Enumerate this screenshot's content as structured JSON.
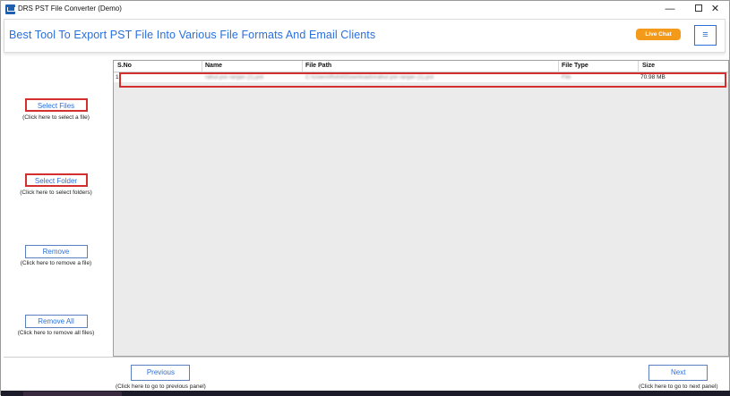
{
  "window": {
    "title": "DRS PST File Converter (Demo)",
    "min_glyph": "—",
    "close_glyph": "✕"
  },
  "header": {
    "title": "Best Tool To Export PST File Into Various File Formats And Email Clients",
    "live_chat": "Live Chat",
    "menu_glyph": "≡"
  },
  "left_panel": {
    "select_files": {
      "label": "Select Files",
      "hint": "(Click here to select a file)"
    },
    "select_folder": {
      "label": "Select Folder",
      "hint": "(Click here to select folders)"
    },
    "remove": {
      "label": "Remove",
      "hint": "(Click here to remove a file)"
    },
    "remove_all": {
      "label": "Remove All",
      "hint": "(Click here to remove all files)"
    }
  },
  "table": {
    "columns": [
      "S.No",
      "Name",
      "File Path",
      "File Type",
      "Size"
    ],
    "rows": [
      {
        "sno": "1",
        "name": "rahul.pst ranjan (1).pst",
        "path": "C:\\Users\\Rohit\\Downloads\\rahul pst ranjan (1).pst",
        "type": "File",
        "size": "70.98 MB"
      }
    ]
  },
  "footer": {
    "previous": {
      "label": "Previous",
      "hint": "(Click here to go to previous panel)"
    },
    "next": {
      "label": "Next",
      "hint": "(Click here to go to next panel)"
    }
  },
  "colors": {
    "accent": "#2a6fdb",
    "live_chat": "#f39a1b",
    "highlight": "#d32f2f"
  }
}
